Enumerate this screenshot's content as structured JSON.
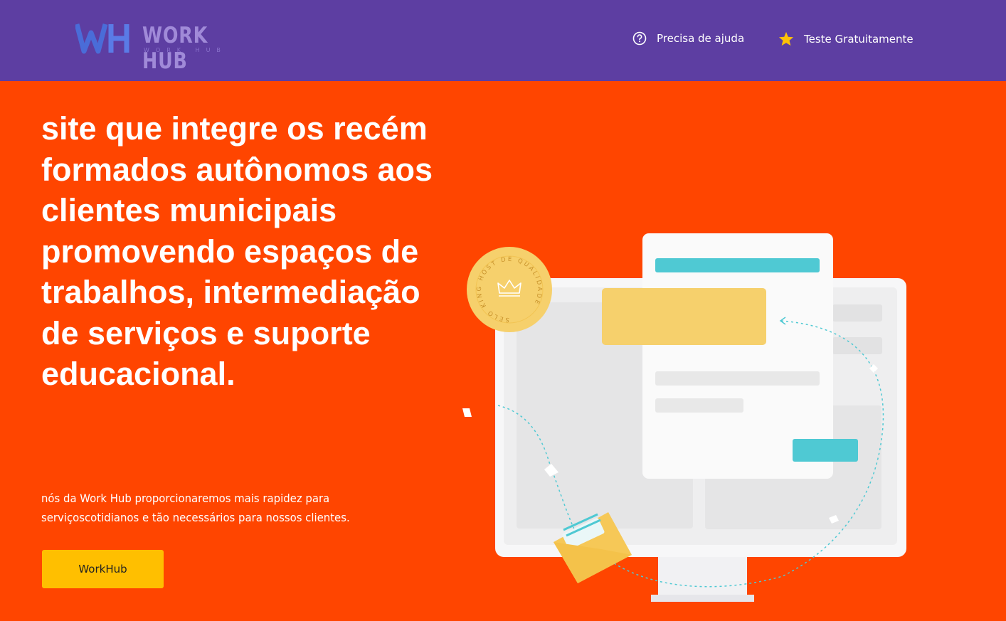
{
  "header": {
    "logo_text": "WORK HUB",
    "logo_subtext": "WORK HUB",
    "nav": [
      {
        "label": "Precisa de ajuda",
        "icon": "question-circle-icon"
      },
      {
        "label": "Teste Gratuitamente",
        "icon": "star-icon"
      }
    ]
  },
  "hero": {
    "title": "site que integre os recém formados autônomos aos clientes municipais promovendo espaços de trabalhos, intermediação de serviços e suporte educacional.",
    "description": "nós da Work Hub proporcionaremos mais rapidez para serviçoscotidianos e tão necessários para nossos clientes.",
    "cta_label": "WorkHub"
  },
  "badge": {
    "text": "SELO KING HOST DE QUALIDADE"
  },
  "colors": {
    "header_bg": "#5d3ea2",
    "hero_bg": "#ff4500",
    "cta_bg": "#ffbf00",
    "accent_teal": "#4fc9d3",
    "accent_yellow": "#f6d06c",
    "star": "#ffc107"
  }
}
